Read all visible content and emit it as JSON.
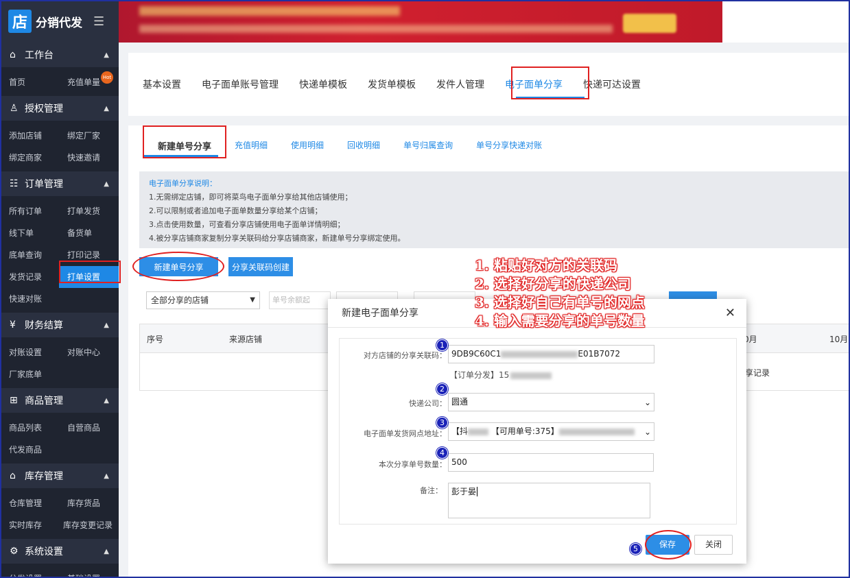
{
  "app": {
    "logo_char": "店",
    "title": "分销代发",
    "menu_toggle": "☰"
  },
  "sidebar": [
    {
      "label": "工作台",
      "icon": "home-icon",
      "glyph": "⌂",
      "items": [
        "首页",
        "充值单量"
      ]
    },
    {
      "label": "授权管理",
      "icon": "user-icon",
      "glyph": "♙",
      "items": [
        "添加店铺",
        "绑定厂家",
        "绑定商家",
        "快速邀请"
      ]
    },
    {
      "label": "订单管理",
      "icon": "order-icon",
      "glyph": "☷",
      "items": [
        "所有订单",
        "打单发货",
        "线下单",
        "备货单",
        "底单查询",
        "打印记录",
        "发货记录",
        "打单设置",
        "快速对账"
      ]
    },
    {
      "label": "财务结算",
      "icon": "yen-icon",
      "glyph": "¥",
      "items": [
        "对账设置",
        "对账中心",
        "厂家底单"
      ]
    },
    {
      "label": "商品管理",
      "icon": "grid-icon",
      "glyph": "⊞",
      "items": [
        "商品列表",
        "自营商品",
        "代发商品"
      ]
    },
    {
      "label": "库存管理",
      "icon": "warehouse-icon",
      "glyph": "⌂",
      "items": [
        "仓库管理",
        "库存货品",
        "实时库存",
        "库存变更记录"
      ]
    },
    {
      "label": "系统设置",
      "icon": "settings-icon",
      "glyph": "⚙",
      "items": [
        "分发设置",
        "基础设置"
      ]
    }
  ],
  "hot_badge": "Hot",
  "top_tabs": [
    "基本设置",
    "电子面单账号管理",
    "快递单模板",
    "发货单模板",
    "发件人管理",
    "电子面单分享",
    "快递可达设置"
  ],
  "sub_tabs": [
    "新建单号分享",
    "充值明细",
    "使用明细",
    "回收明细",
    "单号归属查询",
    "单号分享快递对账"
  ],
  "notice": {
    "heading": "电子面单分享说明：",
    "lines": [
      "1.无需绑定店铺，即可将菜鸟电子面单分享给其他店铺使用；",
      "2.可以限制或者追加电子面单数量分享给某个店铺；",
      "3.点击使用数量，可查看分享店铺使用电子面单详情明细；",
      "4.被分享店铺商家复制分享关联码给分享店铺商家，新建单号分享绑定使用。"
    ]
  },
  "actions": {
    "new_share": "新建单号分享",
    "create_code": "分享关联码创建"
  },
  "filters": {
    "shop_select": "全部分享的店铺",
    "balance_placeholder": "单号余额起",
    "search": "查询"
  },
  "table": {
    "headers": [
      "序号",
      "来源店铺",
      "0月",
      "10月"
    ],
    "row_text": "享记录"
  },
  "modal": {
    "title": "新建电子面单分享",
    "code_label": "对方店铺的分享关联码：",
    "code_value_start": "9DB9C60C1",
    "code_value_end": "E01B7072",
    "code_hint": "【订单分发】15",
    "courier_label": "快递公司：",
    "courier_value": "圆通",
    "branch_label": "电子面单发货网点地址：",
    "branch_prefix": "【抖",
    "branch_mid": "【可用单号:375】",
    "qty_label": "本次分享单号数量：",
    "qty_value": "500",
    "note_label": "备注：",
    "note_value": "彭于晏",
    "save": "保存",
    "close": "关闭"
  },
  "badges": [
    "1",
    "2",
    "3",
    "4",
    "5"
  ],
  "annotation": [
    "1. 粘贴好对方的关联码",
    "2. 选择好分享的快递公司",
    "3. 选择好自己有单号的网点",
    "4. 输入需要分享的单号数量"
  ],
  "colors": {
    "accent": "#1e88e5",
    "sidebar_bg": "#1f2430",
    "highlight_red": "#e02020",
    "badge_blue": "#1a22b8"
  }
}
